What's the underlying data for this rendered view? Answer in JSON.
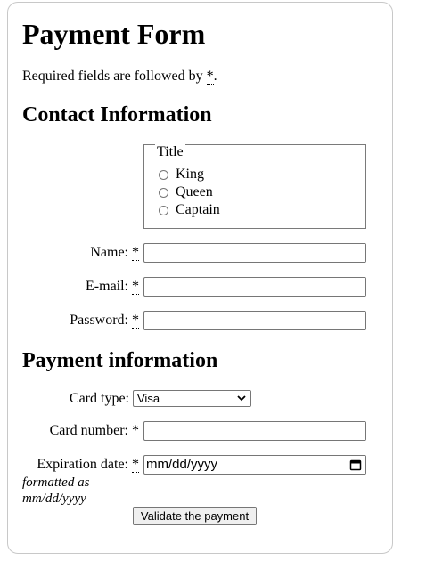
{
  "form": {
    "title": "Payment Form",
    "required_note_prefix": "Required fields are followed by ",
    "required_marker": "*",
    "required_note_suffix": ".",
    "required_tooltip": "required"
  },
  "contact": {
    "heading": "Contact Information",
    "title_legend": "Title",
    "title_options": [
      "King",
      "Queen",
      "Captain"
    ],
    "name_label": "Name:",
    "email_label": "E-mail:",
    "password_label": "Password:",
    "name_value": "",
    "email_value": "",
    "password_value": ""
  },
  "payment": {
    "heading": "Payment information",
    "card_type_label": "Card type:",
    "card_type_selected": "Visa",
    "card_number_label": "Card number:",
    "card_number_required_marker": "*",
    "card_number_value": "",
    "expiration_label": "Expiration date:",
    "expiration_placeholder": "mm/dd/yyyy",
    "expiration_hint": "formatted as mm/dd/yyyy",
    "submit_label": "Validate the payment"
  },
  "icons": {
    "select_chevron": "chevron-down-icon",
    "date_picker": "calendar-icon",
    "radio": "radio-circle"
  },
  "colors": {
    "input_border": "#767676",
    "card_border": "#c8c8c8",
    "button_bg": "#efefef"
  }
}
